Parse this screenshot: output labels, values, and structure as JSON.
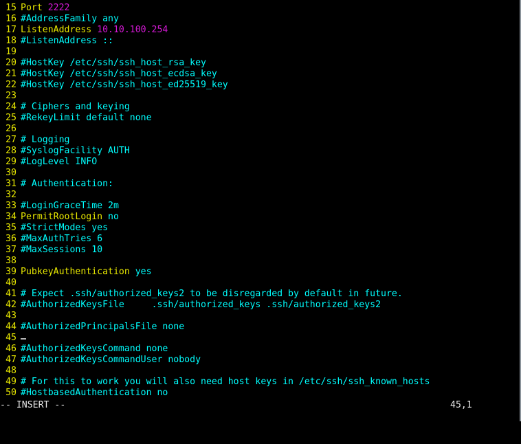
{
  "terminal": {
    "background": "#000000",
    "colors": {
      "line_number": "#e8e800",
      "comment": "#00ffff",
      "keyword": "#e8e800",
      "value": "#00ffff",
      "number": "#d619d6",
      "status_text": "#e8e8e8",
      "cursor": "#b4b4b4"
    }
  },
  "editor": {
    "mode_label": "-- INSERT --",
    "ruler": "45,1",
    "cursor": {
      "line": 45,
      "column": 1
    }
  },
  "lines": [
    {
      "num": "15",
      "segments": [
        {
          "text": "Port ",
          "type": "keyword"
        },
        {
          "text": "2222",
          "type": "number"
        }
      ]
    },
    {
      "num": "16",
      "segments": [
        {
          "text": "#AddressFamily any",
          "type": "comment"
        }
      ]
    },
    {
      "num": "17",
      "segments": [
        {
          "text": "ListenAddress ",
          "type": "keyword"
        },
        {
          "text": "10.10.100.254",
          "type": "number"
        }
      ]
    },
    {
      "num": "18",
      "segments": [
        {
          "text": "#ListenAddress ::",
          "type": "comment"
        }
      ]
    },
    {
      "num": "19",
      "segments": []
    },
    {
      "num": "20",
      "segments": [
        {
          "text": "#HostKey /etc/ssh/ssh_host_rsa_key",
          "type": "comment"
        }
      ]
    },
    {
      "num": "21",
      "segments": [
        {
          "text": "#HostKey /etc/ssh/ssh_host_ecdsa_key",
          "type": "comment"
        }
      ]
    },
    {
      "num": "22",
      "segments": [
        {
          "text": "#HostKey /etc/ssh/ssh_host_ed25519_key",
          "type": "comment"
        }
      ]
    },
    {
      "num": "23",
      "segments": []
    },
    {
      "num": "24",
      "segments": [
        {
          "text": "# Ciphers and keying",
          "type": "comment"
        }
      ]
    },
    {
      "num": "25",
      "segments": [
        {
          "text": "#RekeyLimit default none",
          "type": "comment"
        }
      ]
    },
    {
      "num": "26",
      "segments": []
    },
    {
      "num": "27",
      "segments": [
        {
          "text": "# Logging",
          "type": "comment"
        }
      ]
    },
    {
      "num": "28",
      "segments": [
        {
          "text": "#SyslogFacility AUTH",
          "type": "comment"
        }
      ]
    },
    {
      "num": "29",
      "segments": [
        {
          "text": "#LogLevel INFO",
          "type": "comment"
        }
      ]
    },
    {
      "num": "30",
      "segments": []
    },
    {
      "num": "31",
      "segments": [
        {
          "text": "# Authentication:",
          "type": "comment"
        }
      ]
    },
    {
      "num": "32",
      "segments": []
    },
    {
      "num": "33",
      "segments": [
        {
          "text": "#LoginGraceTime 2m",
          "type": "comment"
        }
      ]
    },
    {
      "num": "34",
      "segments": [
        {
          "text": "PermitRootLogin ",
          "type": "keyword"
        },
        {
          "text": "no",
          "type": "value"
        }
      ]
    },
    {
      "num": "35",
      "segments": [
        {
          "text": "#StrictModes yes",
          "type": "comment"
        }
      ]
    },
    {
      "num": "36",
      "segments": [
        {
          "text": "#MaxAuthTries 6",
          "type": "comment"
        }
      ]
    },
    {
      "num": "37",
      "segments": [
        {
          "text": "#MaxSessions 10",
          "type": "comment"
        }
      ]
    },
    {
      "num": "38",
      "segments": []
    },
    {
      "num": "39",
      "segments": [
        {
          "text": "PubkeyAuthentication ",
          "type": "keyword"
        },
        {
          "text": "yes",
          "type": "value"
        }
      ]
    },
    {
      "num": "40",
      "segments": []
    },
    {
      "num": "41",
      "segments": [
        {
          "text": "# Expect .ssh/authorized_keys2 to be disregarded by default in future.",
          "type": "comment"
        }
      ]
    },
    {
      "num": "42",
      "segments": [
        {
          "text": "#AuthorizedKeysFile\t.ssh/authorized_keys .ssh/authorized_keys2",
          "type": "comment"
        }
      ]
    },
    {
      "num": "43",
      "segments": []
    },
    {
      "num": "44",
      "segments": [
        {
          "text": "#AuthorizedPrincipalsFile none",
          "type": "comment"
        }
      ]
    },
    {
      "num": "45",
      "segments": [],
      "cursor": true
    },
    {
      "num": "46",
      "segments": [
        {
          "text": "#AuthorizedKeysCommand none",
          "type": "comment"
        }
      ]
    },
    {
      "num": "47",
      "segments": [
        {
          "text": "#AuthorizedKeysCommandUser nobody",
          "type": "comment"
        }
      ]
    },
    {
      "num": "48",
      "segments": []
    },
    {
      "num": "49",
      "segments": [
        {
          "text": "# For this to work you will also need host keys in /etc/ssh/ssh_known_hosts",
          "type": "comment"
        }
      ]
    },
    {
      "num": "50",
      "segments": [
        {
          "text": "#HostbasedAuthentication no",
          "type": "comment"
        }
      ]
    }
  ]
}
